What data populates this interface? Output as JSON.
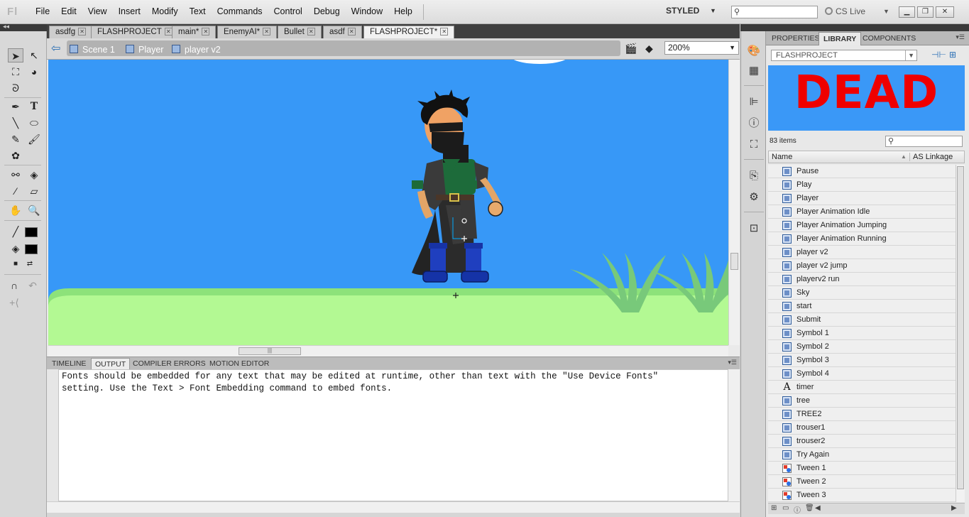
{
  "app": {
    "logo": "Fl",
    "menus": [
      "File",
      "Edit",
      "View",
      "Insert",
      "Modify",
      "Text",
      "Commands",
      "Control",
      "Debug",
      "Window",
      "Help"
    ],
    "workspace": "STYLED",
    "help_search_placeholder": "",
    "cs_live": "CS Live"
  },
  "doc_tabs": [
    {
      "label": "asdfg"
    },
    {
      "label": "FLASHPROJECT"
    },
    {
      "label": "main*"
    },
    {
      "label": "EnemyAI*"
    },
    {
      "label": "Bullet"
    },
    {
      "label": "asdf"
    },
    {
      "label": "FLASHPROJECT*",
      "active": true
    }
  ],
  "editbar": {
    "breadcrumbs": [
      "Scene 1",
      "Player",
      "player v2"
    ],
    "zoom": "200%"
  },
  "bottom_tabs": [
    "TIMELINE",
    "OUTPUT",
    "COMPILER ERRORS",
    "MOTION EDITOR"
  ],
  "output": {
    "text": "Fonts should be embedded for any text that may be edited at runtime, other than text with the \"Use Device Fonts\"\nsetting. Use the Text > Font Embedding command to embed fonts."
  },
  "panel_tabs": [
    "PROPERTIES",
    "LIBRARY",
    "COMPONENTS"
  ],
  "library": {
    "document": "FLASHPROJECT",
    "preview_text": "DEAD",
    "item_count": "83 items",
    "columns": {
      "name": "Name",
      "linkage": "AS Linkage"
    },
    "items": [
      {
        "name": "Pause",
        "icon": "symbol"
      },
      {
        "name": "Play",
        "icon": "symbol"
      },
      {
        "name": "Player",
        "icon": "symbol"
      },
      {
        "name": "Player Animation Idle",
        "icon": "symbol"
      },
      {
        "name": "Player Animation Jumping",
        "icon": "symbol"
      },
      {
        "name": "Player Animation Running",
        "icon": "symbol"
      },
      {
        "name": "player v2",
        "icon": "symbol"
      },
      {
        "name": "player v2 jump",
        "icon": "symbol"
      },
      {
        "name": "playerv2 run",
        "icon": "symbol"
      },
      {
        "name": "Sky",
        "icon": "symbol"
      },
      {
        "name": "start",
        "icon": "symbol"
      },
      {
        "name": "Submit",
        "icon": "symbol"
      },
      {
        "name": "Symbol 1",
        "icon": "symbol"
      },
      {
        "name": "Symbol 2",
        "icon": "symbol"
      },
      {
        "name": "Symbol 3",
        "icon": "symbol"
      },
      {
        "name": "Symbol 4",
        "icon": "symbol"
      },
      {
        "name": "timer",
        "icon": "font"
      },
      {
        "name": "tree",
        "icon": "symbol"
      },
      {
        "name": "TREE2",
        "icon": "symbol"
      },
      {
        "name": "trouser1",
        "icon": "symbol"
      },
      {
        "name": "trouser2",
        "icon": "symbol"
      },
      {
        "name": "Try Again",
        "icon": "symbol"
      },
      {
        "name": "Tween 1",
        "icon": "tween"
      },
      {
        "name": "Tween 2",
        "icon": "tween"
      },
      {
        "name": "Tween 3",
        "icon": "tween"
      }
    ]
  },
  "colors": {
    "stage_sky": "#3798f7",
    "ground": "#b3f993",
    "preview_text": "#ef0000"
  }
}
